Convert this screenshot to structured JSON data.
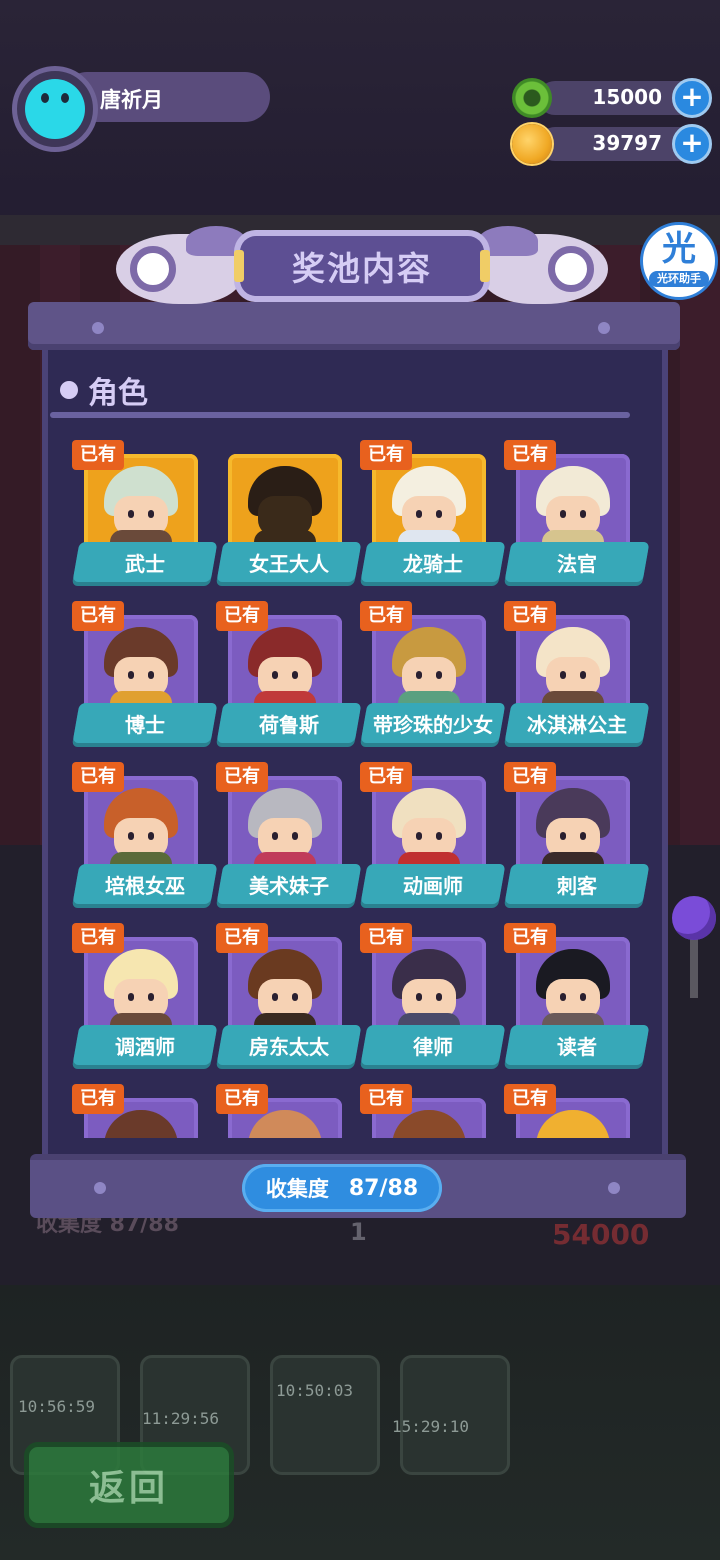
{
  "profile": {
    "name": "唐祈月"
  },
  "currencies": [
    {
      "value": "15000",
      "icon": "green-donut-coin-icon",
      "color": "#6bbf3a"
    },
    {
      "value": "39797",
      "icon": "planet-coin-icon",
      "color": "#f0a824"
    }
  ],
  "helper": {
    "char": "光",
    "caption": "光环助手"
  },
  "modal": {
    "title": "奖池内容",
    "section": "角色",
    "owned_badge": "已有",
    "collection": {
      "label": "收集度",
      "value": "87/88"
    }
  },
  "characters": [
    {
      "name": "武士",
      "owned": true,
      "frame": "gold"
    },
    {
      "name": "女王大人",
      "owned": false,
      "frame": "gold"
    },
    {
      "name": "龙骑士",
      "owned": true,
      "frame": "gold"
    },
    {
      "name": "法官",
      "owned": true,
      "frame": "purple"
    },
    {
      "name": "博士",
      "owned": true,
      "frame": "purple"
    },
    {
      "name": "荷鲁斯",
      "owned": true,
      "frame": "purple"
    },
    {
      "name": "带珍珠的少女",
      "owned": true,
      "frame": "purple"
    },
    {
      "name": "冰淇淋公主",
      "owned": true,
      "frame": "purple"
    },
    {
      "name": "培根女巫",
      "owned": true,
      "frame": "purple"
    },
    {
      "name": "美术妹子",
      "owned": true,
      "frame": "purple"
    },
    {
      "name": "动画师",
      "owned": true,
      "frame": "purple"
    },
    {
      "name": "刺客",
      "owned": true,
      "frame": "purple"
    },
    {
      "name": "调酒师",
      "owned": true,
      "frame": "purple"
    },
    {
      "name": "房东太太",
      "owned": true,
      "frame": "purple"
    },
    {
      "name": "律师",
      "owned": true,
      "frame": "purple"
    },
    {
      "name": "读者",
      "owned": true,
      "frame": "purple"
    },
    {
      "name": "",
      "owned": true,
      "frame": "purple"
    },
    {
      "name": "",
      "owned": true,
      "frame": "purple"
    },
    {
      "name": "",
      "owned": true,
      "frame": "purple"
    },
    {
      "name": "",
      "owned": true,
      "frame": "purple"
    }
  ],
  "background": {
    "timers": [
      "10:56:59",
      "11:29:56",
      "10:50:03",
      "15:29:10"
    ],
    "muted_collection": "收集度  87/88",
    "muted_price": "54000",
    "muted_count": "1"
  },
  "back_button": "返回"
}
